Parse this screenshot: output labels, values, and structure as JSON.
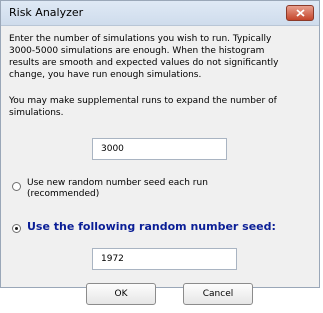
{
  "window": {
    "title": "Risk Analyzer",
    "close_icon": "close-x-icon"
  },
  "intro_text": "Enter the number of simulations you wish to run.  Typically\n3000-5000 simulations are enough.  When the histogram\nresults are smooth and expected values do not significantly\nchange, you have run enough simulations.",
  "supplemental_text": "You may make supplemental runs to expand the number of\nsimulations.",
  "simulations_field": {
    "value": "3000"
  },
  "seed_options": {
    "new_seed_label": "Use new random number seed each run\n(recommended)",
    "new_seed_selected": false,
    "fixed_seed_label": "Use the following random number seed:",
    "fixed_seed_selected": true
  },
  "seed_field": {
    "value": "1972"
  },
  "buttons": {
    "ok": "OK",
    "cancel": "Cancel"
  },
  "colors": {
    "emphasis_label": "#0a1e96",
    "close_button": "#c4452b"
  }
}
